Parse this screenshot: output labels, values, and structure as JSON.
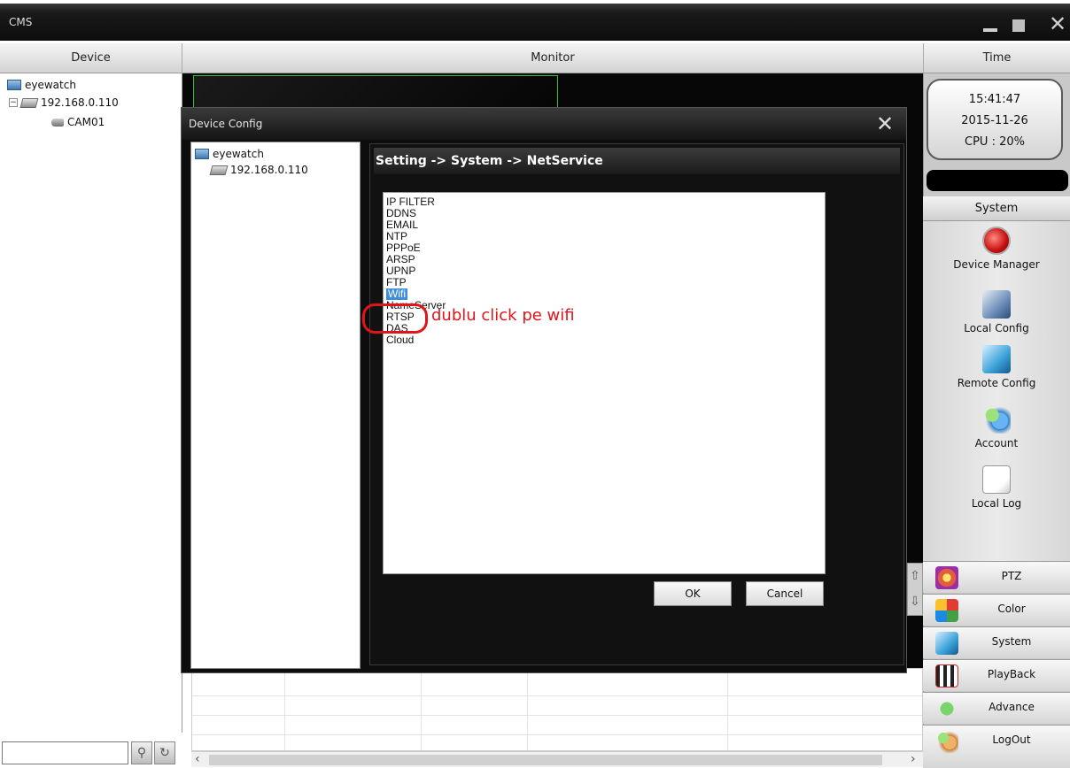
{
  "app": {
    "title": "CMS"
  },
  "header": {
    "device": "Device",
    "monitor": "Monitor",
    "time": "Time"
  },
  "device_tree": {
    "root": "eyewatch",
    "device": "192.168.0.110",
    "camera": "CAM01"
  },
  "clock": {
    "time": "15:41:47",
    "date": "2015-11-26",
    "cpu": "CPU : 20%"
  },
  "system_panel": {
    "header": "System",
    "items": [
      "Device Manager",
      "Local Config",
      "Remote Config",
      "Account",
      "Local Log"
    ]
  },
  "nav_buttons": [
    "PTZ",
    "Color",
    "System",
    "PlayBack",
    "Advance",
    "LogOut"
  ],
  "dialog": {
    "title": "Device Config",
    "tree_root": "eyewatch",
    "tree_device": "192.168.0.110",
    "breadcrumb": "Setting -> System -> NetService",
    "services": [
      "IP FILTER",
      "DDNS",
      "EMAIL",
      "NTP",
      "PPPoE",
      "ARSP",
      "UPNP",
      "FTP",
      "Wifi",
      "NameServer",
      "RTSP",
      "DAS",
      "Cloud"
    ],
    "selected_service": "Wifi",
    "ok_label": "OK",
    "cancel_label": "Cancel"
  },
  "annotation": "dublu click pe wifi",
  "colors": {
    "annotation": "#e0151a",
    "selection": "#3d8fdc",
    "monitor_cell_border": "#39c039"
  }
}
